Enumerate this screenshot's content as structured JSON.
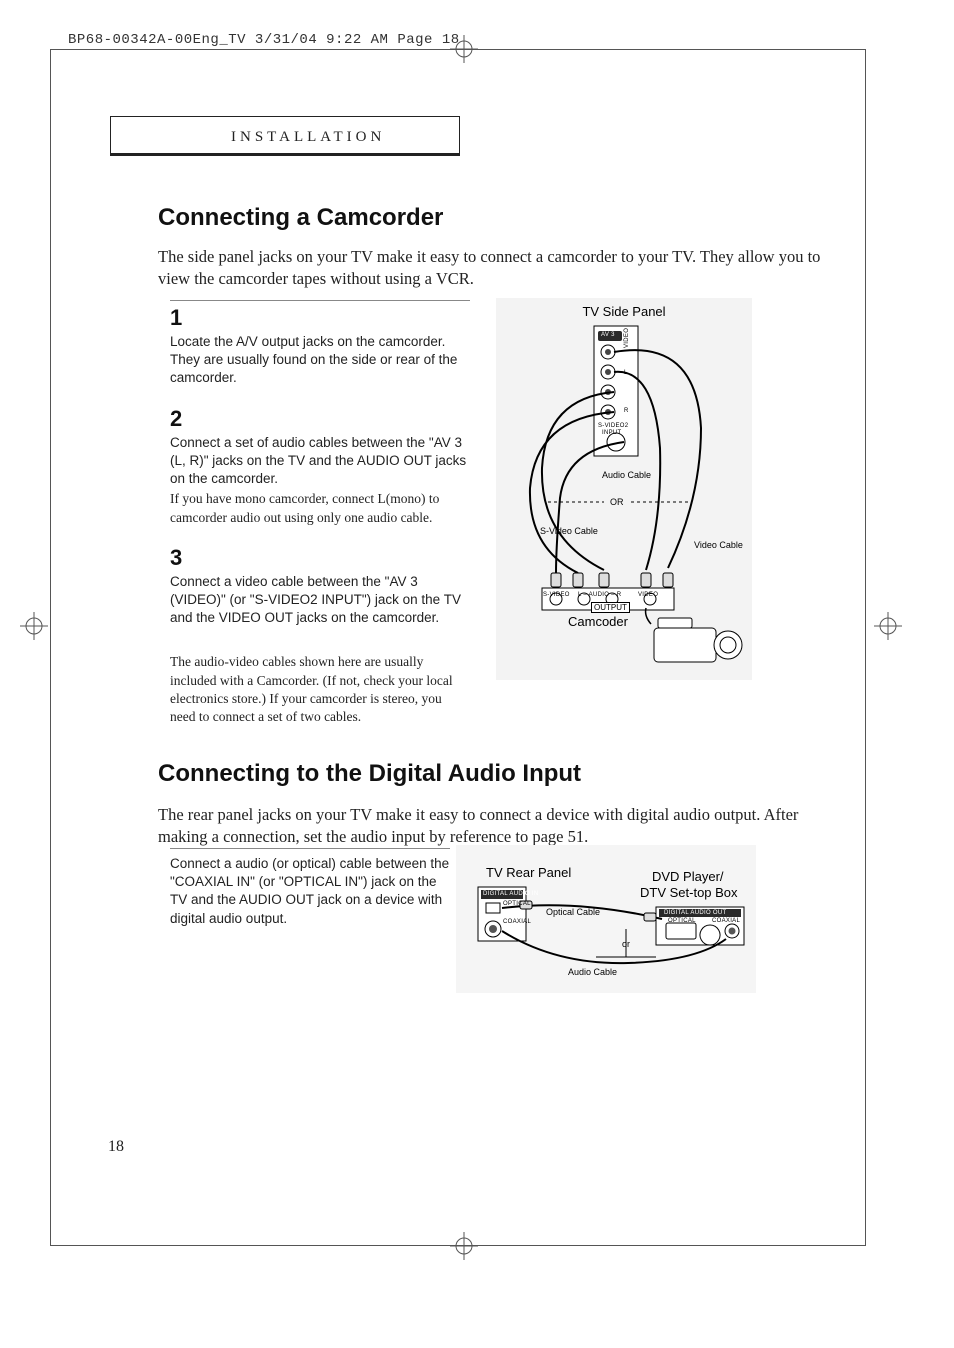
{
  "meta": {
    "header": "BP68-00342A-00Eng_TV  3/31/04  9:22 AM  Page 18"
  },
  "section_tab": "INSTALLATION",
  "section1": {
    "title": "Connecting a Camcorder",
    "intro": "The side panel jacks on your TV make it easy to connect a camcorder to your TV. They allow you to view the camcorder tapes without using a VCR.",
    "steps": [
      {
        "num": "1",
        "body": "Locate the A/V output jacks on the camcorder. They are usually found on the side or rear of the camcorder."
      },
      {
        "num": "2",
        "body": "Connect a set of audio cables between the \"AV 3 (L, R)\" jacks on the TV and the AUDIO OUT jacks on the camcorder.",
        "note": "If you have mono camcorder, connect L(mono) to camcorder audio out using only one audio cable."
      },
      {
        "num": "3",
        "body": "Connect a video cable between the \"AV 3 (VIDEO)\" (or \"S-VIDEO2 INPUT\") jack on the TV and the VIDEO OUT jacks on the camcorder."
      }
    ],
    "footnote": "The audio-video cables shown here are usually included with a Camcorder. (If not, check your local electronics store.) If your camcorder is stereo, you need to connect a set of two cables.",
    "diagram": {
      "title": "TV Side Panel",
      "av3": "AV 3",
      "video": "VIDEO",
      "l": "L",
      "r": "R",
      "svideo2": "S-VIDEO2",
      "input": "INPUT",
      "audio_cable": "Audio Cable",
      "or": "OR",
      "svideo_cable": "S-Video Cable",
      "video_cable": "Video Cable",
      "svideo": "S-VIDEO",
      "l_audio_r": "L – AUDIO – R",
      "video_lbl": "VIDEO",
      "output": "OUTPUT",
      "camcorder": "Camcoder"
    }
  },
  "section2": {
    "title": "Connecting to the Digital Audio Input",
    "intro": "The rear panel jacks on your TV make it easy to connect a device with digital audio output. After making a connection, set the audio input by reference to page 51.",
    "step_body": "Connect a audio (or optical) cable between the \"COAXIAL IN\" (or \"OPTICAL IN\") jack on the TV and the AUDIO OUT jack on a device with digital audio output.",
    "diagram": {
      "rear_panel": "TV Rear Panel",
      "dvd": "DVD Player/",
      "settop": "DTV Set-top Box",
      "digital_audio_in": "DIGITAL AUDIO IN",
      "optical": "OPTICAL",
      "coaxial": "COAXIAL",
      "optical_cable": "Optical Cable",
      "or": "or",
      "audio_cable": "Audio Cable",
      "digital_audio_out": "DIGITAL AUDIO OUT",
      "optical2": "OPTICAL",
      "coaxial2": "COAXIAL"
    }
  },
  "page_number": "18"
}
